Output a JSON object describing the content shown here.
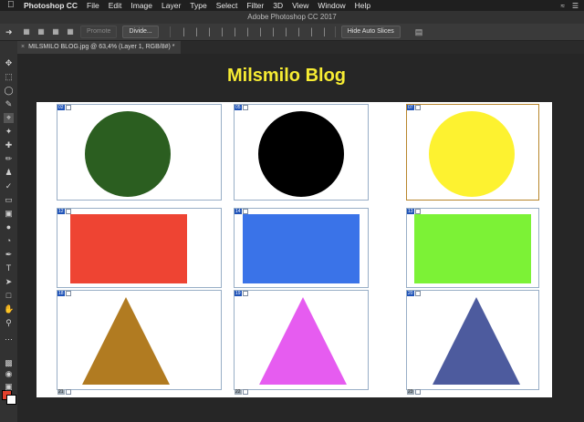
{
  "menubar": {
    "apple": "",
    "app_name": "Photoshop CC",
    "items": [
      "File",
      "Edit",
      "Image",
      "Layer",
      "Type",
      "Select",
      "Filter",
      "3D",
      "View",
      "Window",
      "Help"
    ]
  },
  "window": {
    "title": "Adobe Photoshop CC 2017"
  },
  "options_bar": {
    "promote_label": "Promote",
    "divide_label": "Divide...",
    "hide_auto_slices_label": "Hide Auto Slices"
  },
  "document_tab": {
    "label": "MILSMILO BLOG.jpg @ 63,4% (Layer 1, RGB/8#) *",
    "close": "×"
  },
  "canvas": {
    "title": "Milsmilo Blog"
  },
  "shapes": [
    {
      "name": "green-circle",
      "kind": "circle",
      "color": "#2b5e20"
    },
    {
      "name": "black-circle",
      "kind": "circle",
      "color": "#000000"
    },
    {
      "name": "yellow-circle",
      "kind": "circle",
      "color": "#fdf230"
    },
    {
      "name": "red-rectangle",
      "kind": "rect",
      "color": "#ee4433"
    },
    {
      "name": "blue-rectangle",
      "kind": "rect",
      "color": "#3a73e8"
    },
    {
      "name": "green-rectangle",
      "kind": "rect",
      "color": "#7cf236"
    },
    {
      "name": "brown-triangle",
      "kind": "triangle",
      "color": "#b17b21"
    },
    {
      "name": "magenta-triangle",
      "kind": "triangle",
      "color": "#e65cf0"
    },
    {
      "name": "navy-triangle",
      "kind": "triangle",
      "color": "#4d5b9e"
    }
  ],
  "slice_numbers": {
    "row1": [
      "02",
      "05",
      "07"
    ],
    "row2": [
      "12",
      "14",
      "13"
    ],
    "row3": [
      "18",
      "19",
      "20"
    ],
    "bottom": [
      "21",
      "22",
      "23"
    ]
  },
  "colors": {
    "foreground": "#e4412d",
    "background": "#ffffff",
    "title_color": "#f7ec33"
  }
}
